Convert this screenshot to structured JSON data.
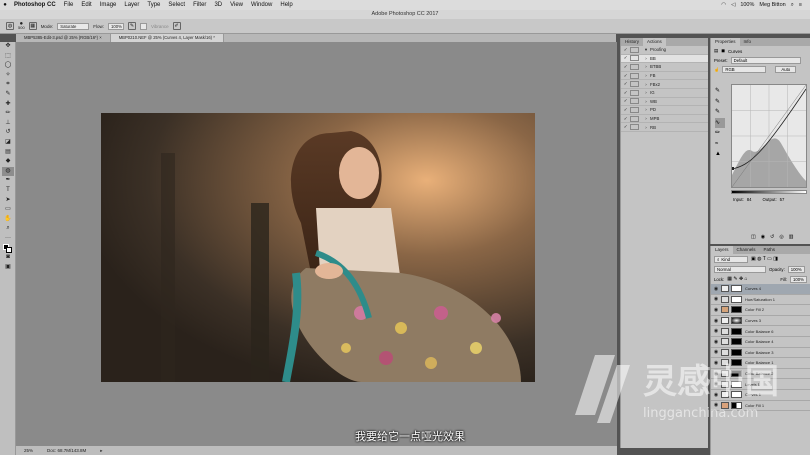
{
  "menubar": {
    "app": "Photoshop CC",
    "items": [
      "File",
      "Edit",
      "Image",
      "Layer",
      "Type",
      "Select",
      "Filter",
      "3D",
      "View",
      "Window",
      "Help"
    ],
    "user": "Meg Bitton",
    "battery": "100%"
  },
  "window_title": "Adobe Photoshop CC 2017",
  "options": {
    "brush_size": "500",
    "mode_label": "Mode:",
    "mode_value": "Saturate",
    "flow_label": "Flow:",
    "flow_value": "100%",
    "vibrance_label": "Vibrance"
  },
  "tabs": [
    {
      "label": "MBP5385-Edit-3.psd @ 25% (RGB/16*) ×",
      "active": false
    },
    {
      "label": "MBP0210.NEF @ 25% (Curves 4, Layer Mask/16) *",
      "active": true
    }
  ],
  "status": {
    "zoom": "25%",
    "doc": "Doc: 68.7M/143.8M"
  },
  "subtitle": "我要给它一点哑光效果",
  "panels": {
    "history_tab": "History",
    "actions_tab": "Actions",
    "actions": [
      {
        "label": "Proofing",
        "open": true
      },
      {
        "label": "BB",
        "selected": true
      },
      {
        "label": "BTBB"
      },
      {
        "label": "FB"
      },
      {
        "label": "FBx2"
      },
      {
        "label": "IG"
      },
      {
        "label": "WB"
      },
      {
        "label": "PD"
      },
      {
        "label": "MPB"
      },
      {
        "label": "RB"
      }
    ],
    "properties_tab": "Properties",
    "info_tab": "Info",
    "curves_title": "Curves",
    "preset_label": "Preset:",
    "preset_value": "Default",
    "channel_value": "RGB",
    "auto_label": "Auto",
    "input_label": "Input:",
    "input_value": "84",
    "output_label": "Output:",
    "output_value": "57",
    "layers_tab": "Layers",
    "channels_tab": "Channels",
    "paths_tab": "Paths",
    "kind_label": "Kind",
    "blend_mode": "Normal",
    "opacity_label": "Opacity:",
    "opacity_value": "100%",
    "lock_label": "Lock:",
    "fill_label": "Fill:",
    "fill_value": "100%",
    "layers": [
      {
        "name": "Curves 4",
        "selected": true
      },
      {
        "name": "Hue/Saturation 1"
      },
      {
        "name": "Color Fill 2"
      },
      {
        "name": "Curves 3"
      },
      {
        "name": "Color Balance 6"
      },
      {
        "name": "Color Balance 4"
      },
      {
        "name": "Color Balance 3"
      },
      {
        "name": "Color Balance 1"
      },
      {
        "name": "Color Balance 2"
      },
      {
        "name": "Levels 1"
      },
      {
        "name": "Curves 1"
      },
      {
        "name": "Color Fill 1"
      }
    ]
  },
  "watermark": {
    "brand": "灵感中国",
    "url": "lingganchina.com"
  }
}
